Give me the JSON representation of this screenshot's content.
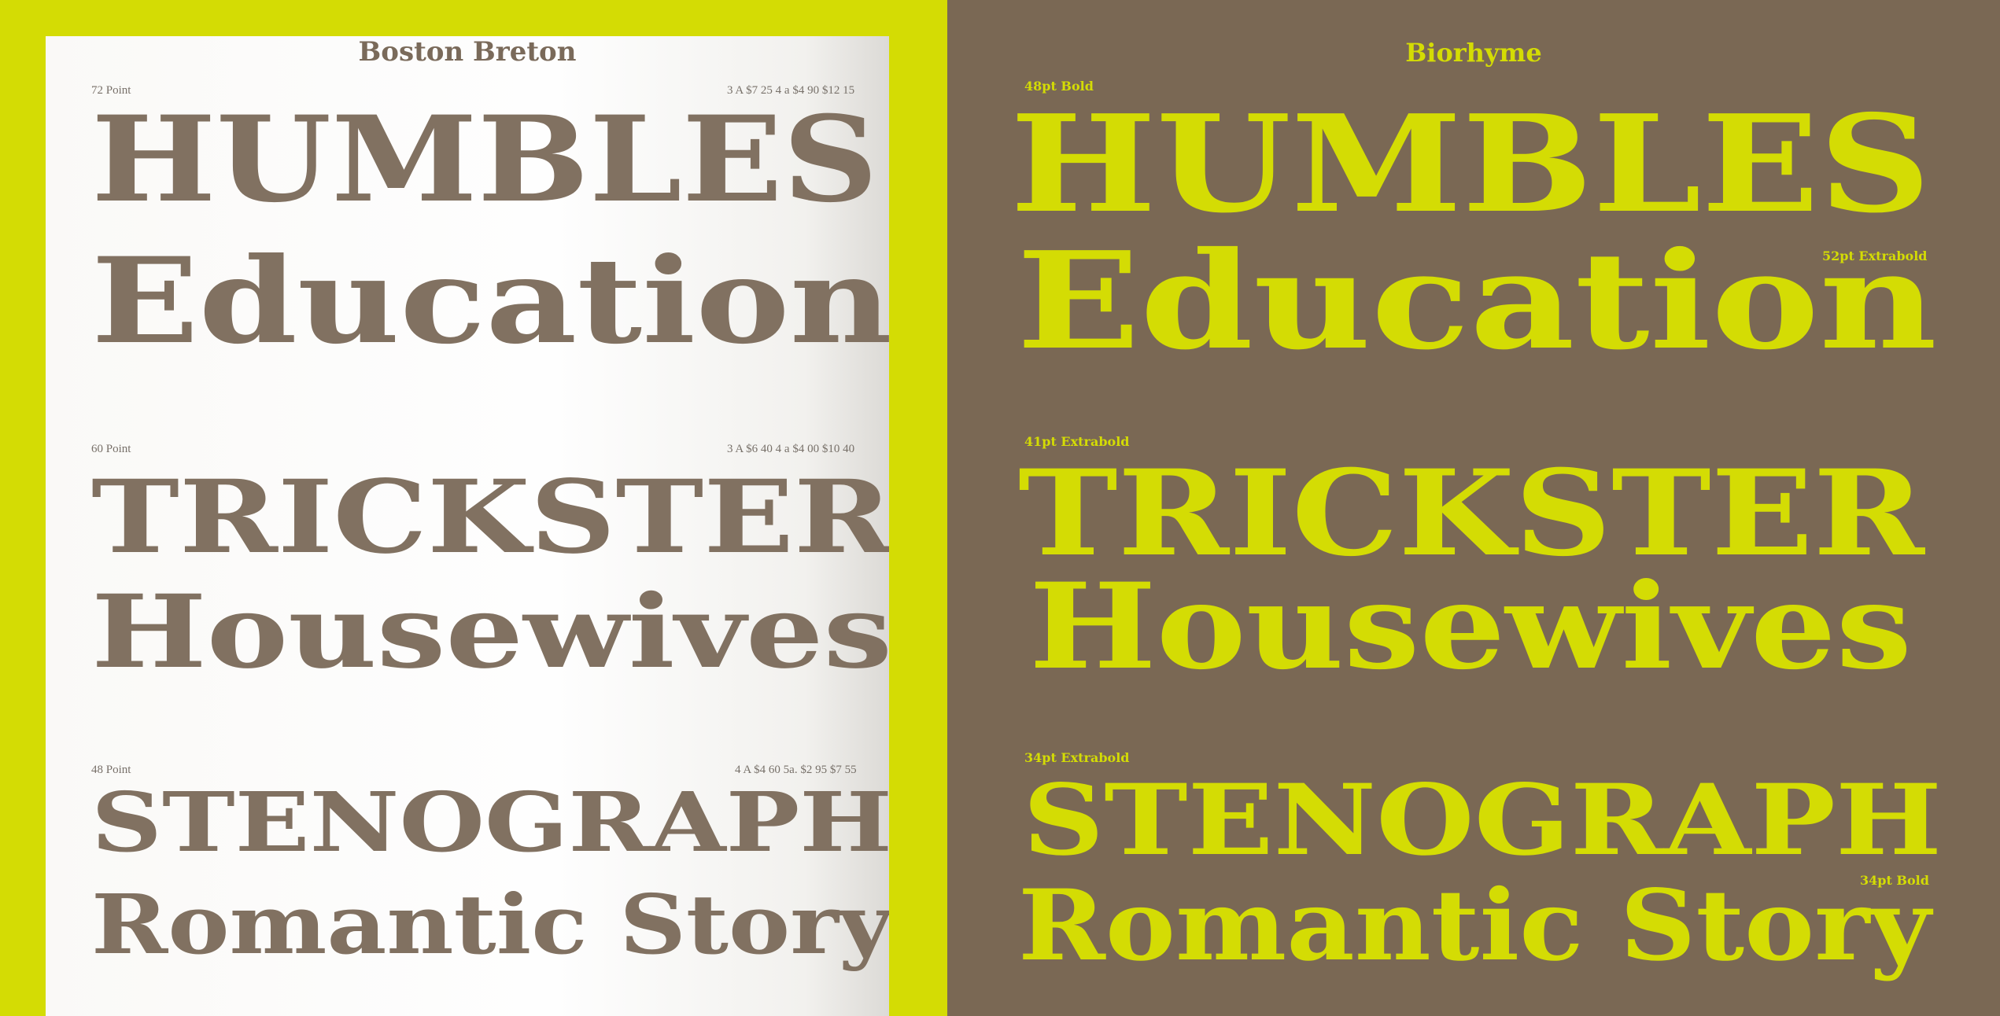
{
  "colors": {
    "lime": "#d4dc04",
    "brown": "#7a6854",
    "specimen_ink": "#817161",
    "paper": "#fefefe"
  },
  "left": {
    "title": "Boston Breton",
    "blocks": [
      {
        "size_label": "72 Point",
        "price": "3 A $7 25   4 a $4 90   $12 15",
        "line1": "HUMBLES",
        "line2": "Education"
      },
      {
        "size_label": "60 Point",
        "price": "3 A $6 40   4 a $4 00   $10 40",
        "line1": "TRICKSTER",
        "line2": "Housewives"
      },
      {
        "size_label": "48 Point",
        "price": "4 A $4 60   5a. $2 95   $7 55",
        "line1": "STENOGRAPH",
        "line2": "Romantic Story"
      }
    ]
  },
  "right": {
    "title": "Biorhyme",
    "labels": {
      "humbles": "48pt Bold",
      "education": "52pt Extrabold",
      "trickster": "41pt Extrabold",
      "stenograph": "34pt Extrabold",
      "romantic": "34pt Bold"
    },
    "lines": {
      "humbles": "HUMBLES",
      "education": "Education",
      "trickster": "TRICKSTER",
      "housewives": "Housewives",
      "stenograph": "STENOGRAPH",
      "romantic": "Romantic Story"
    }
  }
}
